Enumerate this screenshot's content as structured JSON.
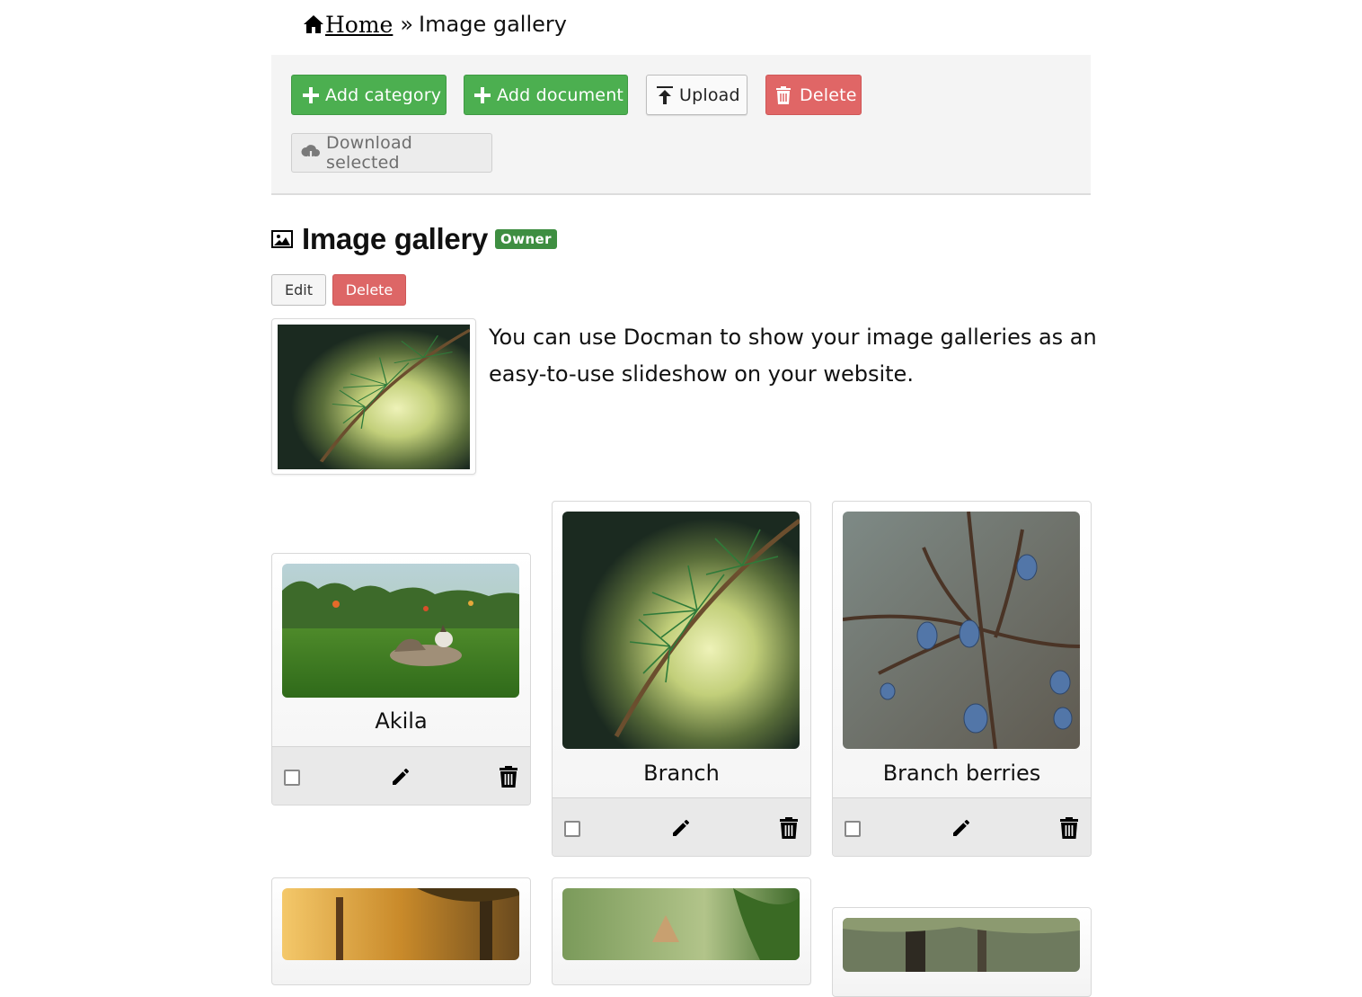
{
  "breadcrumb": {
    "home": "Home",
    "separator": "»",
    "current": "Image gallery"
  },
  "toolbar": {
    "add_category": "Add category",
    "add_document": "Add document",
    "upload": "Upload",
    "delete": "Delete",
    "download_selected": "Download selected"
  },
  "category": {
    "title": "Image gallery",
    "badge": "Owner",
    "edit": "Edit",
    "delete": "Delete",
    "description": "You can use Docman to show your image galleries as an easy-to-use slideshow on your website."
  },
  "documents": [
    {
      "title": "Akila",
      "image": "husky-on-lawn"
    },
    {
      "title": "Branch",
      "image": "pine-branch"
    },
    {
      "title": "Branch berries",
      "image": "blue-berries-on-branch"
    },
    {
      "title": "",
      "image": "sunlit-trees"
    },
    {
      "title": "",
      "image": "green-foliage"
    },
    {
      "title": "",
      "image": "forest-tree-trunk"
    }
  ],
  "colors": {
    "add_button": "#4caf50",
    "delete_button": "#e06666",
    "owner_badge": "#3e8e41",
    "toolbar_background": "#f4f4f4"
  }
}
